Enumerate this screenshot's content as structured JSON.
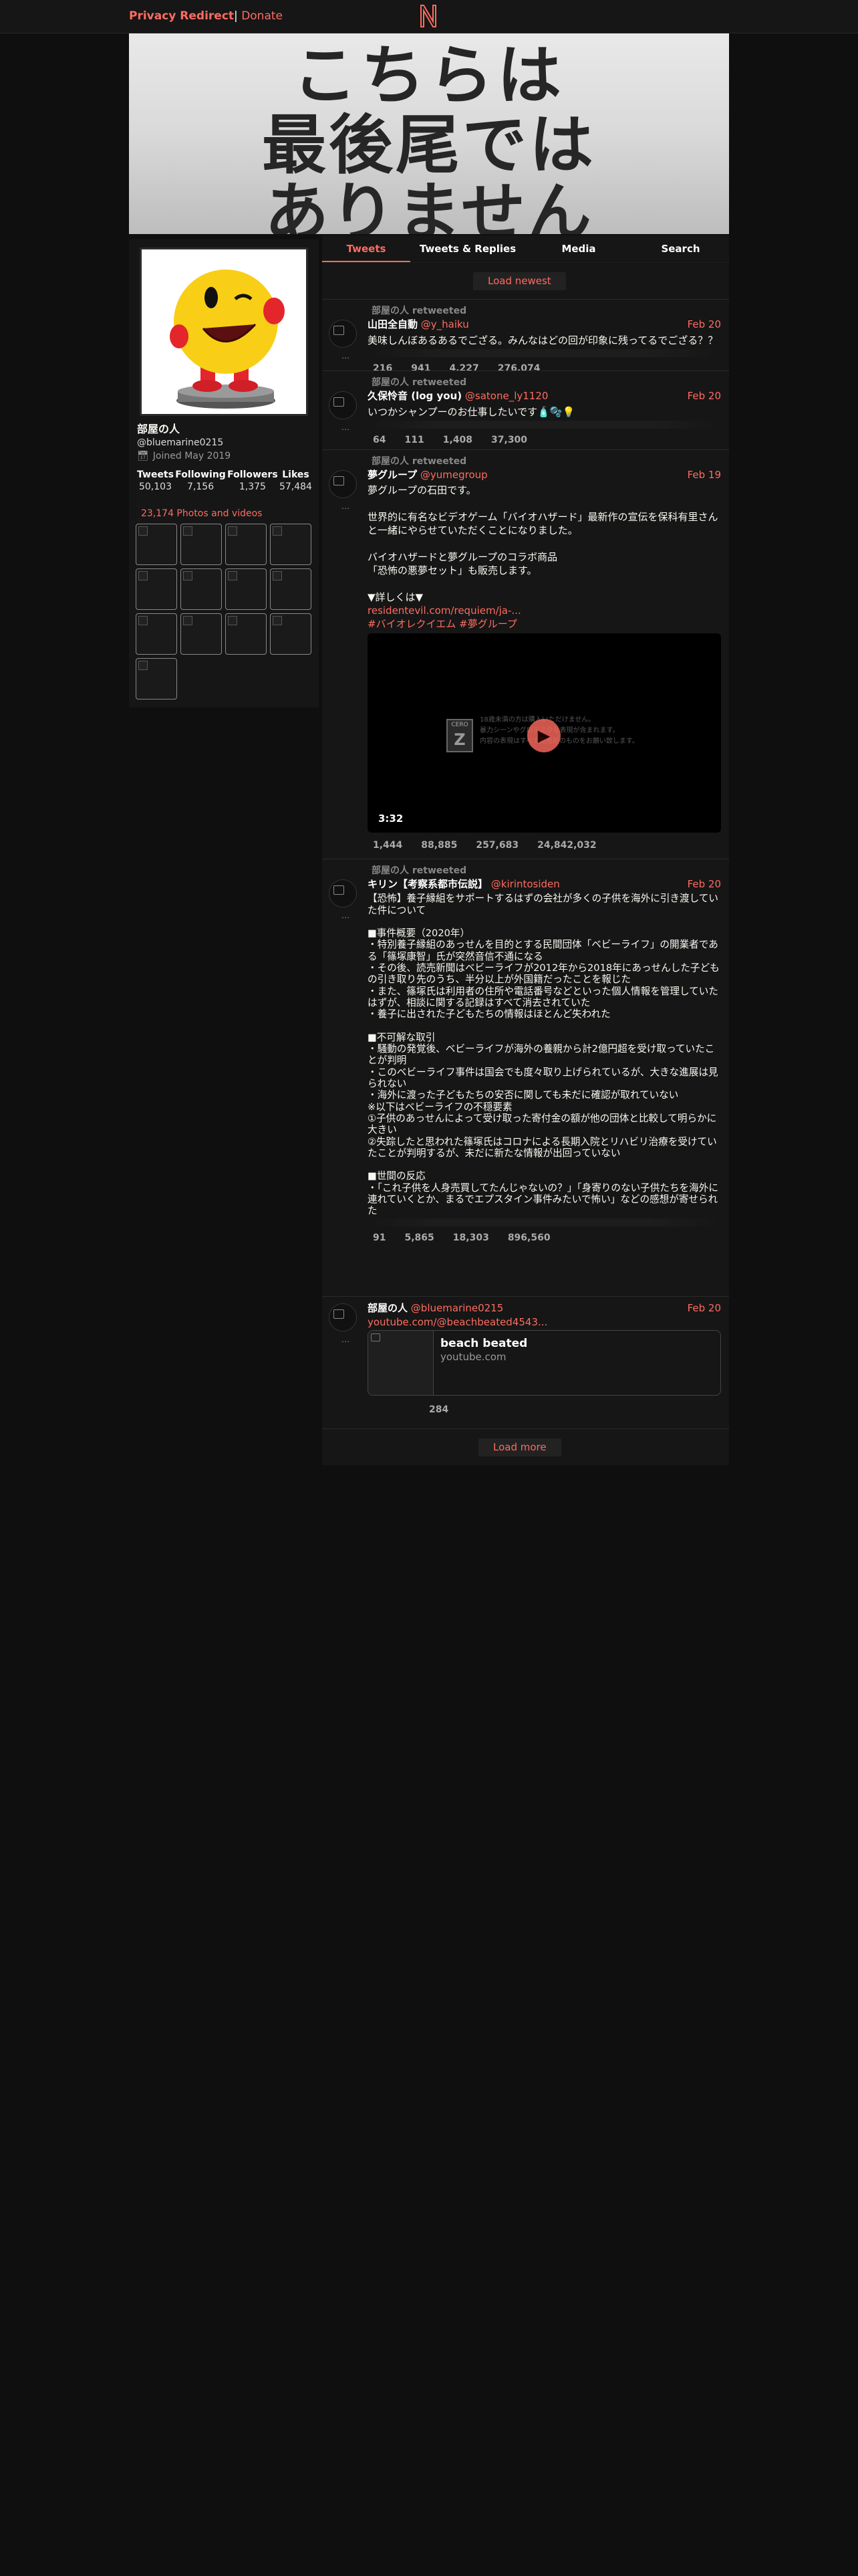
{
  "nav": {
    "privacy_label": "Privacy Redirect",
    "separator": "|",
    "donate_label": "Donate",
    "logo_letter": "N",
    "icons": [
      "rss-icon",
      "search-icon",
      "rss-icon",
      "github-icon",
      "settings-icon"
    ],
    "icon_glyphs": [
      "",
      "",
      "",
      "",
      ""
    ]
  },
  "banner": {
    "line1": "こちらは",
    "line2": "最後尾では",
    "line3": "ありません"
  },
  "profile": {
    "name": "部屋の人",
    "handle": "@bluemarine0215",
    "joined_icon": "calendar-icon",
    "joined": "Joined May 2019",
    "stats": [
      {
        "label": "Tweets",
        "value": "50,103"
      },
      {
        "label": "Following",
        "value": "7,156"
      },
      {
        "label": "Followers",
        "value": "1,375"
      },
      {
        "label": "Likes",
        "value": "57,484"
      }
    ],
    "media_label": "23,174 Photos and videos",
    "media_glyph": ""
  },
  "tabs": [
    {
      "label": "Tweets",
      "active": true
    },
    {
      "label": "Tweets & Replies",
      "active": false
    },
    {
      "label": "Media",
      "active": false
    },
    {
      "label": "Search",
      "active": false
    }
  ],
  "load_newest": "Load newest",
  "load_more": "Load more",
  "scroll_top_glyph": "",
  "glyphs": {
    "retweet": "",
    "verified": "",
    "comment": "",
    "rt": "",
    "quote": "",
    "like": "",
    "play": "▶"
  },
  "tweets": [
    {
      "retweet_by": "部屋の人 retweeted",
      "name": "山田全自動",
      "badge": "",
      "handle": "@y_haiku",
      "date": "Feb 20",
      "text": "美味しんぼあるあるでござる。みんなはどの回が印象に残ってるでござる？？",
      "stats": [
        "216",
        "941",
        "4,227",
        "276,074"
      ]
    },
    {
      "retweet_by": "部屋の人 retweeted",
      "name": "久保怜音 (log you)",
      "badge": "",
      "handle": "@satone_ly1120",
      "date": "Feb 20",
      "text": "いつかシャンプーのお仕事したいです🧴🫧💡",
      "stats": [
        "64",
        "111",
        "1,408",
        "37,300"
      ]
    },
    {
      "retweet_by": "部屋の人 retweeted",
      "name": "夢グループ",
      "badge": "",
      "handle": "@yumegroup",
      "date": "Feb 19",
      "text": "夢グループの石田です。\n\n世界的に有名なビデオゲーム「バイオハザード」最新作の宣伝を保科有里さんと一緒にやらせていただくことになりました。\n\nバイオハザードと夢グループのコラボ商品\n「恐怖の悪夢セット」も販売します。\n\n▼詳しくは▼",
      "link": "residentevil.com/requiem/ja-...",
      "hashtags": "#バイオレクイエム #夢グループ",
      "video_duration": "3:32",
      "video_notice_l1": "18歳未満の方は購入いただけません。",
      "video_notice_l2": "暴力シーンやグロテスクな表現が含まれます。",
      "video_notice_l3": "内容の表現はすべて発売前のものをお願い致します。",
      "stats": [
        "1,444",
        "88,885",
        "257,683",
        "24,842,032"
      ]
    },
    {
      "retweet_by": "部屋の人 retweeted",
      "name": "キリン【考察系都市伝説】",
      "badge": "",
      "handle": "@kirintosiden",
      "date": "Feb 20",
      "text": "【恐怖】養子縁組をサポートするはずの会社が多くの子供を海外に引き渡していた件について\n\n■事件概要（2020年）\n・特別養子縁組のあっせんを目的とする民間団体「ベビーライフ」の開業者である「篠塚康智」氏が突然音信不通になる\n・その後、読売新聞はベビーライフが2012年から2018年にあっせんした子どもの引き取り先のうち、半分以上が外国籍だったことを報じた\n・また、篠塚氏は利用者の住所や電話番号などといった個人情報を管理していたはずが、相談に関する記録はすべて消去されていた\n・養子に出された子どもたちの情報はほとんど失われた\n\n■不可解な取引\n・騒動の発覚後、ベビーライフが海外の養親から計2億円超を受け取っていたことが判明\n・このベビーライフ事件は国会でも度々取り上げられているが、大きな進展は見られない\n・海外に渡った子どもたちの安否に関しても未だに確認が取れていない\n※以下はベビーライフの不穏要素\n①子供のあっせんによって受け取った寄付金の額が他の団体と比較して明らかに大きい\n②失踪したと思われた篠塚氏はコロナによる長期入院とリハビリ治療を受けていたことが判明するが、未だに新たな情報が出回っていない\n\n■世間の反応\n・「これ子供を人身売買してたんじゃないの？」「身寄りのない子供たちを海外に連れていくとか、まるでエプスタイン事件みたいで怖い」などの感想が寄せられた",
      "stats": [
        "91",
        "5,865",
        "18,303",
        "896,560"
      ]
    },
    {
      "retweet_by": "",
      "name": "部屋の人",
      "badge": "",
      "handle": "@bluemarine0215",
      "date": "Feb 20",
      "text": "",
      "link": "youtube.com/@beachbeated4543...",
      "card_title": "beach beated",
      "card_domain": "youtube.com",
      "stats": [
        "",
        "",
        "",
        "284"
      ]
    }
  ]
}
